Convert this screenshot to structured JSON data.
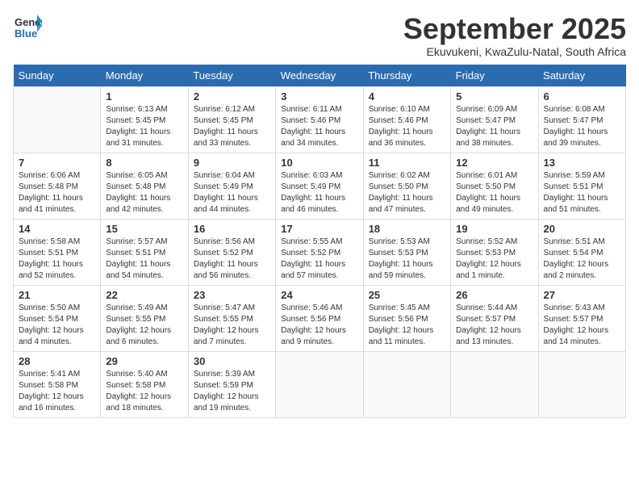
{
  "logo": {
    "line1": "General",
    "line2": "Blue"
  },
  "title": "September 2025",
  "subtitle": "Ekuvukeni, KwaZulu-Natal, South Africa",
  "days_of_week": [
    "Sunday",
    "Monday",
    "Tuesday",
    "Wednesday",
    "Thursday",
    "Friday",
    "Saturday"
  ],
  "weeks": [
    [
      {
        "day": "",
        "info": ""
      },
      {
        "day": "1",
        "info": "Sunrise: 6:13 AM\nSunset: 5:45 PM\nDaylight: 11 hours\nand 31 minutes."
      },
      {
        "day": "2",
        "info": "Sunrise: 6:12 AM\nSunset: 5:45 PM\nDaylight: 11 hours\nand 33 minutes."
      },
      {
        "day": "3",
        "info": "Sunrise: 6:11 AM\nSunset: 5:46 PM\nDaylight: 11 hours\nand 34 minutes."
      },
      {
        "day": "4",
        "info": "Sunrise: 6:10 AM\nSunset: 5:46 PM\nDaylight: 11 hours\nand 36 minutes."
      },
      {
        "day": "5",
        "info": "Sunrise: 6:09 AM\nSunset: 5:47 PM\nDaylight: 11 hours\nand 38 minutes."
      },
      {
        "day": "6",
        "info": "Sunrise: 6:08 AM\nSunset: 5:47 PM\nDaylight: 11 hours\nand 39 minutes."
      }
    ],
    [
      {
        "day": "7",
        "info": "Sunrise: 6:06 AM\nSunset: 5:48 PM\nDaylight: 11 hours\nand 41 minutes."
      },
      {
        "day": "8",
        "info": "Sunrise: 6:05 AM\nSunset: 5:48 PM\nDaylight: 11 hours\nand 42 minutes."
      },
      {
        "day": "9",
        "info": "Sunrise: 6:04 AM\nSunset: 5:49 PM\nDaylight: 11 hours\nand 44 minutes."
      },
      {
        "day": "10",
        "info": "Sunrise: 6:03 AM\nSunset: 5:49 PM\nDaylight: 11 hours\nand 46 minutes."
      },
      {
        "day": "11",
        "info": "Sunrise: 6:02 AM\nSunset: 5:50 PM\nDaylight: 11 hours\nand 47 minutes."
      },
      {
        "day": "12",
        "info": "Sunrise: 6:01 AM\nSunset: 5:50 PM\nDaylight: 11 hours\nand 49 minutes."
      },
      {
        "day": "13",
        "info": "Sunrise: 5:59 AM\nSunset: 5:51 PM\nDaylight: 11 hours\nand 51 minutes."
      }
    ],
    [
      {
        "day": "14",
        "info": "Sunrise: 5:58 AM\nSunset: 5:51 PM\nDaylight: 11 hours\nand 52 minutes."
      },
      {
        "day": "15",
        "info": "Sunrise: 5:57 AM\nSunset: 5:51 PM\nDaylight: 11 hours\nand 54 minutes."
      },
      {
        "day": "16",
        "info": "Sunrise: 5:56 AM\nSunset: 5:52 PM\nDaylight: 11 hours\nand 56 minutes."
      },
      {
        "day": "17",
        "info": "Sunrise: 5:55 AM\nSunset: 5:52 PM\nDaylight: 11 hours\nand 57 minutes."
      },
      {
        "day": "18",
        "info": "Sunrise: 5:53 AM\nSunset: 5:53 PM\nDaylight: 11 hours\nand 59 minutes."
      },
      {
        "day": "19",
        "info": "Sunrise: 5:52 AM\nSunset: 5:53 PM\nDaylight: 12 hours\nand 1 minute."
      },
      {
        "day": "20",
        "info": "Sunrise: 5:51 AM\nSunset: 5:54 PM\nDaylight: 12 hours\nand 2 minutes."
      }
    ],
    [
      {
        "day": "21",
        "info": "Sunrise: 5:50 AM\nSunset: 5:54 PM\nDaylight: 12 hours\nand 4 minutes."
      },
      {
        "day": "22",
        "info": "Sunrise: 5:49 AM\nSunset: 5:55 PM\nDaylight: 12 hours\nand 6 minutes."
      },
      {
        "day": "23",
        "info": "Sunrise: 5:47 AM\nSunset: 5:55 PM\nDaylight: 12 hours\nand 7 minutes."
      },
      {
        "day": "24",
        "info": "Sunrise: 5:46 AM\nSunset: 5:56 PM\nDaylight: 12 hours\nand 9 minutes."
      },
      {
        "day": "25",
        "info": "Sunrise: 5:45 AM\nSunset: 5:56 PM\nDaylight: 12 hours\nand 11 minutes."
      },
      {
        "day": "26",
        "info": "Sunrise: 5:44 AM\nSunset: 5:57 PM\nDaylight: 12 hours\nand 13 minutes."
      },
      {
        "day": "27",
        "info": "Sunrise: 5:43 AM\nSunset: 5:57 PM\nDaylight: 12 hours\nand 14 minutes."
      }
    ],
    [
      {
        "day": "28",
        "info": "Sunrise: 5:41 AM\nSunset: 5:58 PM\nDaylight: 12 hours\nand 16 minutes."
      },
      {
        "day": "29",
        "info": "Sunrise: 5:40 AM\nSunset: 5:58 PM\nDaylight: 12 hours\nand 18 minutes."
      },
      {
        "day": "30",
        "info": "Sunrise: 5:39 AM\nSunset: 5:59 PM\nDaylight: 12 hours\nand 19 minutes."
      },
      {
        "day": "",
        "info": ""
      },
      {
        "day": "",
        "info": ""
      },
      {
        "day": "",
        "info": ""
      },
      {
        "day": "",
        "info": ""
      }
    ]
  ]
}
